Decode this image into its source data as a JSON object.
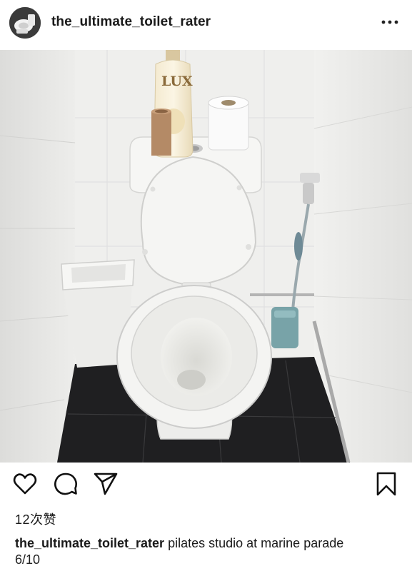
{
  "header": {
    "username": "the_ultimate_toilet_rater",
    "avatar_icon": "toilet-avatar-icon",
    "more_icon": "more-dots-icon"
  },
  "photo": {
    "bottle_label": "LUX"
  },
  "actions": {
    "like_icon": "heart-icon",
    "comment_icon": "comment-icon",
    "share_icon": "paper-plane-icon",
    "save_icon": "bookmark-icon"
  },
  "likes": "12次赞",
  "caption": {
    "username": "the_ultimate_toilet_rater",
    "text": "pilates studio at marine parade",
    "rating": "6/10"
  }
}
